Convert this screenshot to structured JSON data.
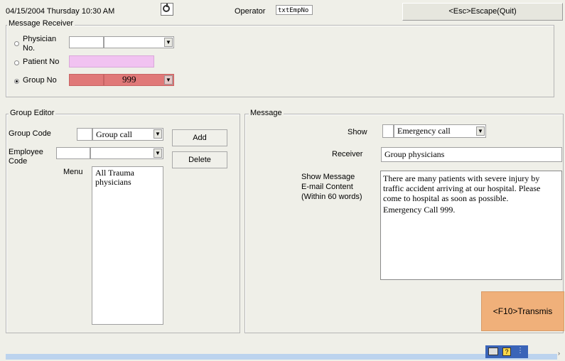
{
  "header": {
    "datetime": "04/15/2004 Thursday 10:30 AM",
    "operator_label": "Operator",
    "operator_value": "txtEmpNo",
    "escape_button": "<Esc>Escape(Quit)"
  },
  "receiver": {
    "legend": "Message Receiver",
    "physician_label_line1": "Physician",
    "physician_label_line2": "No.",
    "patient_label": "Patient No",
    "group_label": "Group No",
    "group_value": "999",
    "selected": "Group No"
  },
  "group_editor": {
    "legend": "Group Editor",
    "group_code_label": "Group Code",
    "group_code_combo": "Group call",
    "employee_code_label_line1": "Employee",
    "employee_code_label_line2": "Code",
    "menu_label": "Menu",
    "menu_items": [
      "All Trauma physicians"
    ],
    "add_button": "Add",
    "delete_button": "Delete"
  },
  "message": {
    "legend": "Message",
    "show_label": "Show",
    "show_combo": "Emergency call",
    "receiver_label": "Receiver",
    "receiver_value": "Group physicians",
    "content_label_line1": "Show Message",
    "content_label_line2": "E-mail Content",
    "content_label_line3": "(Within 60 words)",
    "content_paragraph1": "There are many patients with severe injury by traffic accident arriving at our hospital.  Please come to hospital as soon as possible.",
    "content_paragraph2": "Emergency Call 999.",
    "transmit_button": "<F10>Transmis"
  },
  "colors": {
    "background": "#efefe8",
    "patient_field": "#f1c2f1",
    "group_field": "#e07878",
    "transmit_button": "#f0b07a",
    "status_bar": "#bcd3ee",
    "tray": "#3a64b8"
  },
  "icons": [
    "clock-icon",
    "keyboard-icon",
    "help-icon"
  ]
}
